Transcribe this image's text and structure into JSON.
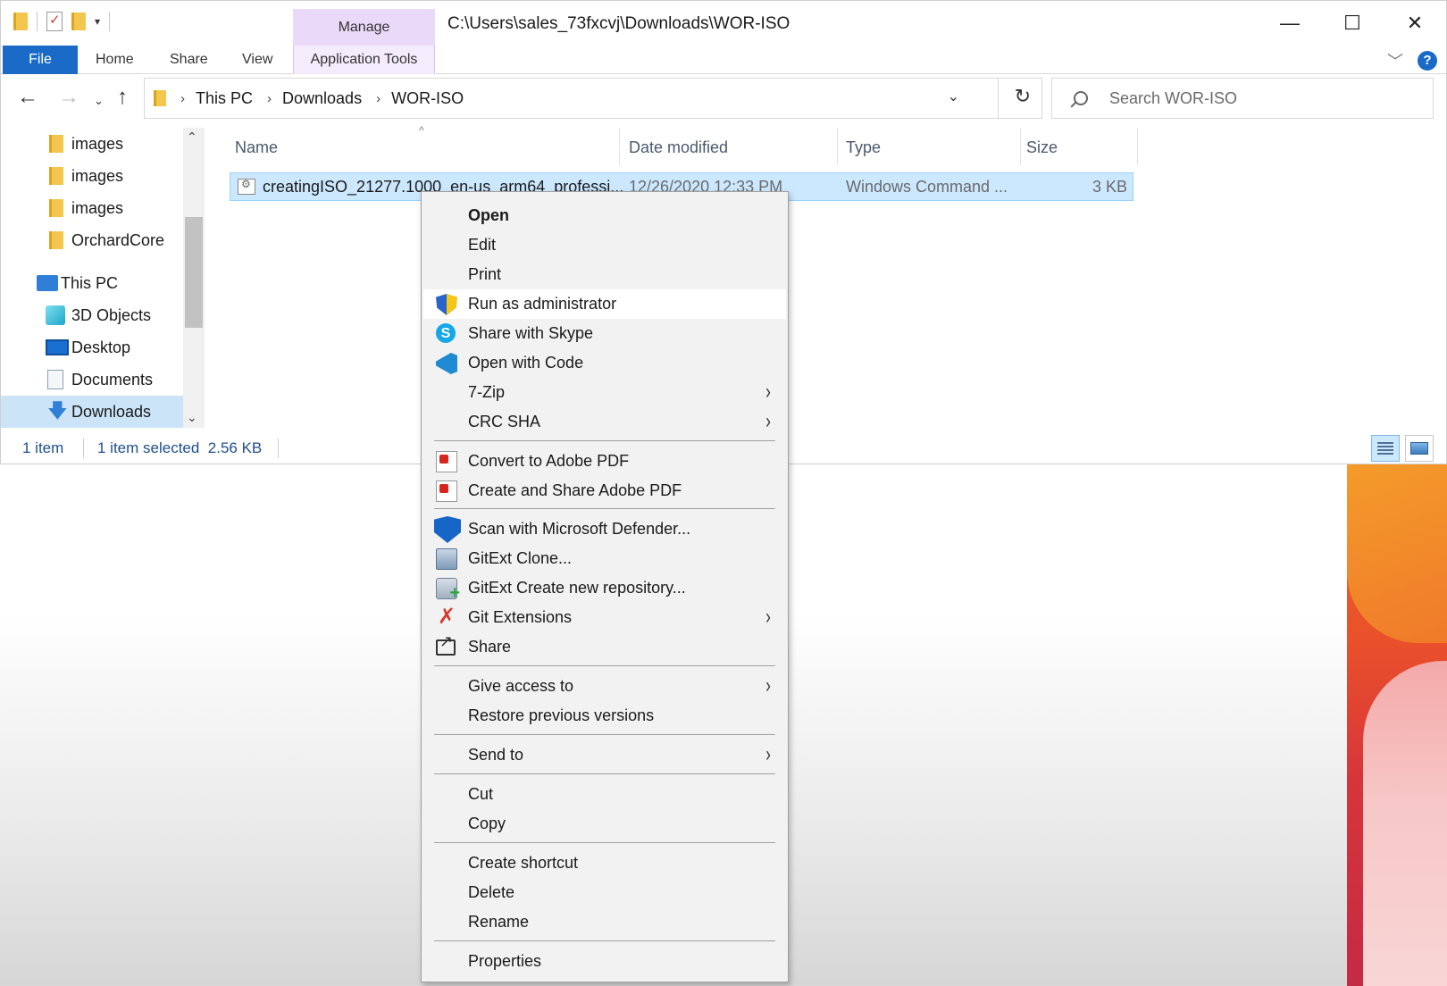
{
  "window": {
    "title_path": "C:\\Users\\sales_73fxcvj\\Downloads\\WOR-ISO",
    "manage_tab": "Manage",
    "controls": {
      "minimize": "—",
      "maximize": "☐",
      "close": "✕"
    }
  },
  "ribbon": {
    "tabs": {
      "file": "File",
      "home": "Home",
      "share": "Share",
      "view": "View",
      "app_tools": "Application Tools"
    },
    "help": "?",
    "expand": "﹀"
  },
  "navigation": {
    "back": "←",
    "forward": "→",
    "recent": "⌄",
    "up": "↑",
    "breadcrumb": [
      "This PC",
      "Downloads",
      "WOR-ISO"
    ],
    "crumb_sep": "›",
    "dropdown": "⌄",
    "refresh": "↻",
    "search_placeholder": "Search WOR-ISO"
  },
  "nav_pane": {
    "items": [
      {
        "label": "images",
        "icon": "folder-icon"
      },
      {
        "label": "images",
        "icon": "folder-icon"
      },
      {
        "label": "images",
        "icon": "folder-icon"
      },
      {
        "label": "OrchardCore",
        "icon": "folder-icon"
      },
      {
        "label": "This PC",
        "icon": "pc-icon"
      },
      {
        "label": "3D Objects",
        "icon": "3d-objects-icon"
      },
      {
        "label": "Desktop",
        "icon": "desktop-icon"
      },
      {
        "label": "Documents",
        "icon": "documents-icon"
      },
      {
        "label": "Downloads",
        "icon": "downloads-icon",
        "selected": true
      }
    ],
    "scroll_up": "⌃",
    "scroll_down": "⌄"
  },
  "file_list": {
    "columns": {
      "name": "Name",
      "date": "Date modified",
      "type": "Type",
      "size": "Size"
    },
    "sort_indicator": "^",
    "rows": [
      {
        "name": "creatingISO_21277.1000_en-us_arm64_professi...",
        "date": "12/26/2020 12:33 PM",
        "type": "Windows Command ...",
        "size": "3 KB",
        "selected": true
      }
    ]
  },
  "status": {
    "item_count": "1 item",
    "selection": "1 item selected  2.56 KB"
  },
  "context_menu": {
    "items": [
      {
        "label": "Open",
        "bold": true
      },
      {
        "label": "Edit"
      },
      {
        "label": "Print"
      },
      {
        "label": "Run as administrator",
        "icon": "uac-shield-icon",
        "hover": true
      },
      {
        "label": "Share with Skype",
        "icon": "skype-icon"
      },
      {
        "label": "Open with Code",
        "icon": "vscode-icon"
      },
      {
        "label": "7-Zip",
        "submenu": true
      },
      {
        "label": "CRC SHA",
        "submenu": true
      },
      {
        "label": "Convert to Adobe PDF",
        "icon": "adobe-pdf-icon"
      },
      {
        "label": "Create and Share Adobe PDF",
        "icon": "adobe-pdf-share-icon"
      },
      {
        "label": "Scan with Microsoft Defender...",
        "icon": "defender-icon"
      },
      {
        "label": "GitExt Clone...",
        "icon": "gitext-clone-icon"
      },
      {
        "label": "GitExt Create new repository...",
        "icon": "gitext-repo-icon"
      },
      {
        "label": "Git Extensions",
        "icon": "git-extensions-icon",
        "submenu": true
      },
      {
        "label": "Share",
        "icon": "share-icon"
      },
      {
        "label": "Give access to",
        "submenu": true
      },
      {
        "label": "Restore previous versions"
      },
      {
        "label": "Send to",
        "submenu": true
      },
      {
        "label": "Cut"
      },
      {
        "label": "Copy"
      },
      {
        "label": "Create shortcut"
      },
      {
        "label": "Delete"
      },
      {
        "label": "Rename"
      },
      {
        "label": "Properties"
      }
    ],
    "submenu_glyph": "›"
  },
  "colors": {
    "accent": "#1a6ac8",
    "selection": "#cce8ff",
    "manage_tab": "#ead9f8"
  }
}
